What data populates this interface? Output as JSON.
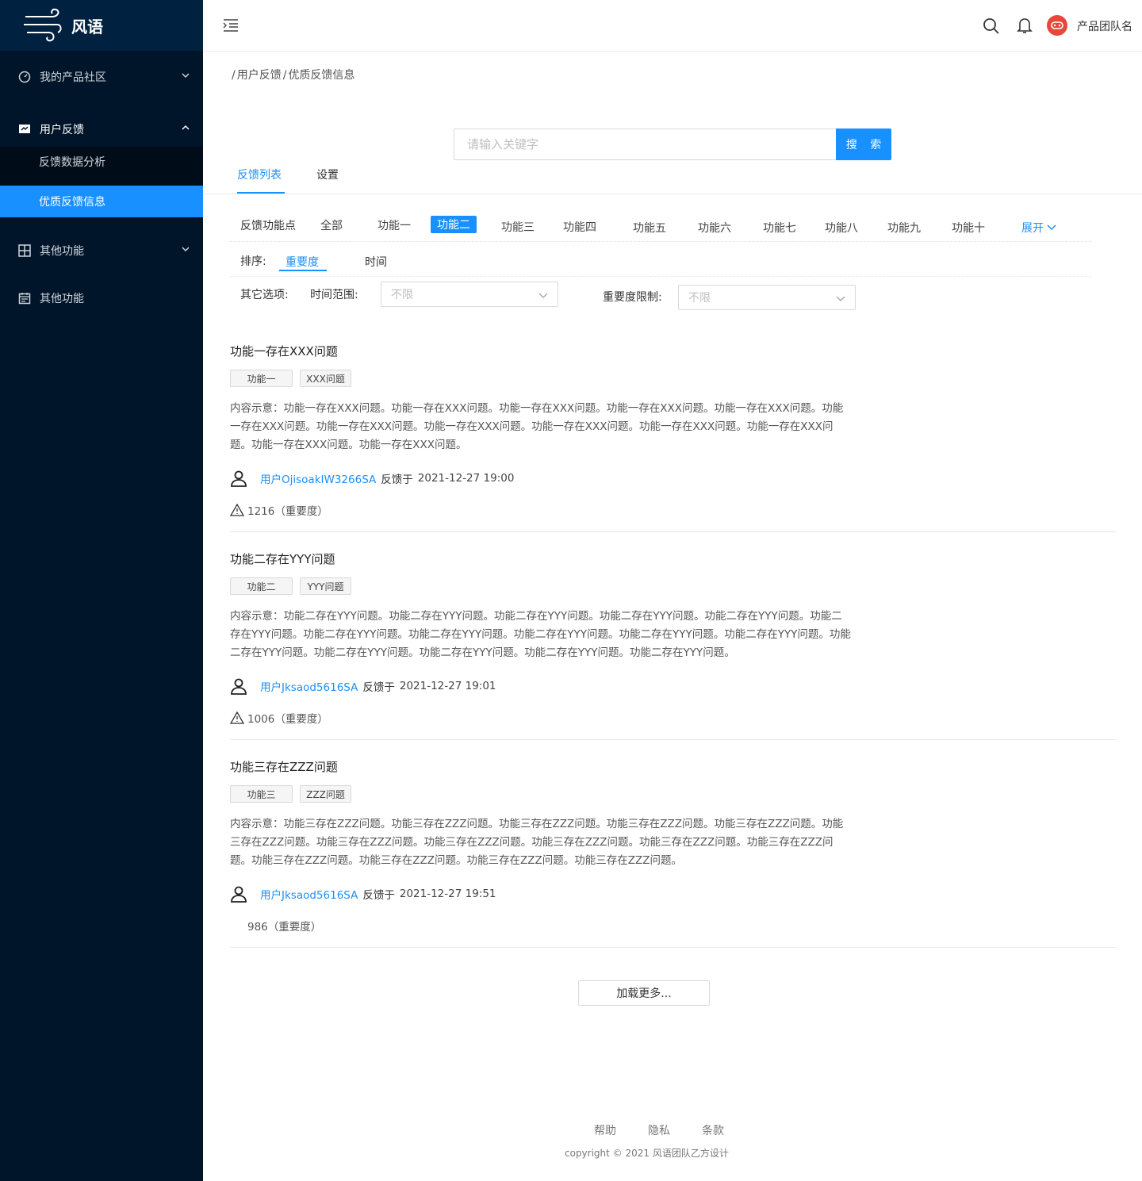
{
  "app": {
    "name": "风语"
  },
  "sidebar": {
    "menu1": "我的产品社区",
    "menu2": "用户反馈",
    "sub1": "反馈数据分析",
    "sub2": "优质反馈信息",
    "menu3": "其他功能",
    "menu4": "其他功能"
  },
  "header": {
    "team": "产品团队名"
  },
  "breadcrumb": {
    "sep": "/",
    "item1": "用户反馈",
    "item2": "优质反馈信息"
  },
  "search": {
    "placeholder": "请输入关键字",
    "button": "搜 索"
  },
  "tabs": {
    "tab1": "反馈列表",
    "tab2": "设置"
  },
  "filters": {
    "feature_label": "反馈功能点",
    "features": [
      "全部",
      "功能一",
      "功能二",
      "功能三",
      "功能四",
      "功能五",
      "功能六",
      "功能七",
      "功能八",
      "功能九",
      "功能十"
    ],
    "expand": "展开",
    "sort_label": "排序:",
    "sort_importance": "重要度",
    "sort_time": "时间",
    "other_label": "其它选项:",
    "time_range_label": "时间范围:",
    "time_range_value": "不限",
    "importance_label": "重要度限制:",
    "importance_value": "不限"
  },
  "items": [
    {
      "title": "功能一存在XXX问题",
      "tag1": "功能一",
      "tag2": "XXX问题",
      "content": "内容示意：功能一存在XXX问题。功能一存在XXX问题。功能一存在XXX问题。功能一存在XXX问题。功能一存在XXX问题。功能一存在XXX问题。功能一存在XXX问题。功能一存在XXX问题。功能一存在XXX问题。功能一存在XXX问题。功能一存在XXX问题。功能一存在XXX问题。功能一存在XXX问题。",
      "user": "用户OjisoakIW3266SA",
      "fb_label": "反馈于",
      "time": "2021-12-27 19:00",
      "score": "1216（重要度）"
    },
    {
      "title": "功能二存在YYY问题",
      "tag1": "功能二",
      "tag2": "YYY问题",
      "content": "内容示意：功能二存在YYY问题。功能二存在YYY问题。功能二存在YYY问题。功能二存在YYY问题。功能二存在YYY问题。功能二存在YYY问题。功能二存在YYY问题。功能二存在YYY问题。功能二存在YYY问题。功能二存在YYY问题。功能二存在YYY问题。功能二存在YYY问题。功能二存在YYY问题。功能二存在YYY问题。功能二存在YYY问题。功能二存在YYY问题。",
      "user": "用户Jksaod5616SA",
      "fb_label": "反馈于",
      "time": "2021-12-27 19:01",
      "score": "1006（重要度）"
    },
    {
      "title": "功能三存在ZZZ问题",
      "tag1": "功能三",
      "tag2": "ZZZ问题",
      "content": "内容示意：功能三存在ZZZ问题。功能三存在ZZZ问题。功能三存在ZZZ问题。功能三存在ZZZ问题。功能三存在ZZZ问题。功能三存在ZZZ问题。功能三存在ZZZ问题。功能三存在ZZZ问题。功能三存在ZZZ问题。功能三存在ZZZ问题。功能三存在ZZZ问题。功能三存在ZZZ问题。功能三存在ZZZ问题。功能三存在ZZZ问题。功能三存在ZZZ问题。",
      "user": "用户Jksaod5616SA",
      "fb_label": "反馈于",
      "time": "2021-12-27 19:51",
      "score": "986（重要度）"
    }
  ],
  "load_more": "加载更多...",
  "footer": {
    "help": "帮助",
    "privacy": "隐私",
    "terms": "条款",
    "copyright": "copyright © 2021 风语团队乙方设计"
  },
  "colors": {
    "sidebar_bg": "#001529",
    "brand_bg": "#002140",
    "accent": "#1890ff",
    "avatar": "#e8473b"
  }
}
